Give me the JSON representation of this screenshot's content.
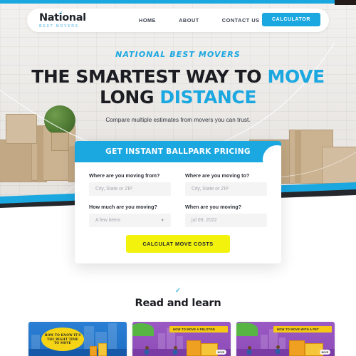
{
  "brand": {
    "logo_main": "National",
    "logo_sub": "BEST MOVERS",
    "logo_check_icon": "check-icon"
  },
  "nav": {
    "links": [
      {
        "label": "HOME"
      },
      {
        "label": "ABOUT"
      },
      {
        "label": "CONTACT US"
      }
    ],
    "cta_label": "CALCULATOR",
    "cta_color": "#1ba7e0"
  },
  "hero": {
    "eyebrow": "NATIONAL BEST MOVERS",
    "heading_line1_plain": "THE SMARTEST WAY TO ",
    "heading_line1_accent": "MOVE",
    "heading_line2_plain": "LONG ",
    "heading_line2_accent": "DISTANCE",
    "accent_color": "#1ba7e0",
    "subtitle": "Compare multiple estimates from movers you can trust."
  },
  "form": {
    "header_title": "GET INSTANT BALLPARK PRICING",
    "header_color": "#1ba7e0",
    "fields": {
      "from": {
        "label": "Where are you moving from?",
        "placeholder": "City, State or ZIP",
        "value": ""
      },
      "to": {
        "label": "Where are you moving to?",
        "placeholder": "City, State or ZIP",
        "value": ""
      },
      "amount": {
        "label": "How much are you moving?",
        "value": "A few items",
        "caret_icon": "chevron-down-icon"
      },
      "date": {
        "label": "When are you moving?",
        "value": "jul 09, 2022"
      }
    },
    "submit_label": "CALCULAT MOVE COSTS",
    "submit_color": "#f2f20d"
  },
  "learn": {
    "check_icon": "check-icon",
    "title": "Read and learn",
    "cards": [
      {
        "title": "HOW TO KNOW IT'S THE RIGHT TIME TO MOVE",
        "style": "bubble",
        "bg_color": "#2a7fd4"
      },
      {
        "title": "HOW TO MOVE A PELOTON",
        "style": "banner",
        "bg_color": "#9b59c4",
        "button_label": "MOVE"
      },
      {
        "title": "HOW TO MOVE WITH A PET",
        "style": "banner",
        "bg_color": "#9b59c4",
        "button_label": "MOVE"
      }
    ]
  }
}
